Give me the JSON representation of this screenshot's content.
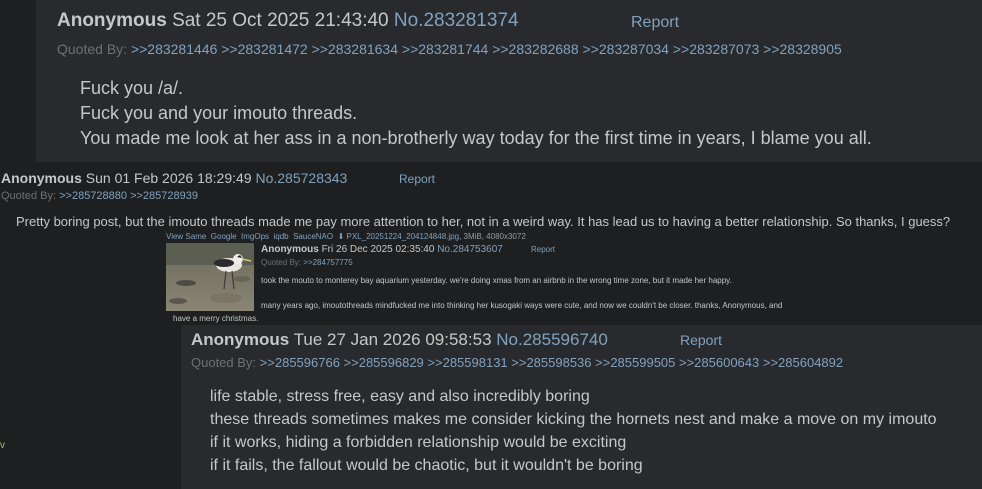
{
  "post1": {
    "name": "Anonymous",
    "datetime": "Sat 25 Oct 2025 21:43:40",
    "number": "No.283281374",
    "report": "Report",
    "quoted_label": "Quoted By:",
    "quoted": ">>283281446 >>283281472 >>283281634 >>283281744 >>283282688 >>283287034 >>283287073 >>28328905",
    "lines": [
      "Fuck you /a/.",
      "Fuck you and your imouto threads.",
      "You made me look at her ass in a non-brotherly way today for the first time in years, I blame you all."
    ]
  },
  "post2": {
    "name": "Anonymous",
    "datetime": "Sun 01 Feb 2026 18:29:49",
    "number": "No.285728343",
    "report": "Report",
    "quoted_label": "Quoted By:",
    "quoted": ">>285728880 >>285728939",
    "line": "Pretty boring post, but the imouto threads made me pay more attention to her, not in a weird way. It has lead us to having a better relationship. So thanks, I guess?"
  },
  "post3": {
    "file_tools": [
      "View Same",
      "Google",
      "ImgOps",
      "iqdb",
      "SauceNAO"
    ],
    "download_icon": "download-icon",
    "filename": "PXL_20251224_204124848.jpg",
    "fileinfo": ", 3MiB, 4080x3072",
    "name": "Anonymous",
    "datetime": "Fri 26 Dec 2025 02:35:40",
    "number": "No.284753607",
    "report": "Report",
    "quoted_label": "Quoted By:",
    "quoted": ">>284757775",
    "line1": "took the mouto to monterey bay aquarium yesterday. we're doing xmas from an airbnb in the wrong time zone, but it made her happy.",
    "line2": "many years ago, imoutothreads mindfucked me into thinking her kusogaki ways were cute, and now we couldn't be closer. thanks, Anonymous, and",
    "line3": "have a merry christmas."
  },
  "post4": {
    "name": "Anonymous",
    "datetime": "Tue 27 Jan 2026 09:58:53",
    "number": "No.285596740",
    "report": "Report",
    "quoted_label": "Quoted By:",
    "quoted": ">>285596766 >>285596829 >>285598131 >>285598536 >>285599505 >>285600643 >>285604892",
    "lines": [
      "life stable, stress free, easy and also incredibly boring",
      "these threads sometimes makes me consider kicking the hornets nest and make a move on my imouto",
      "if it works, hiding a forbidden relationship would be exciting",
      "if it fails, the fallout would be chaotic, but it wouldn't be boring"
    ]
  },
  "edge_mark": "v",
  "colors": {
    "background": "#1d1f21",
    "post_background": "#282a2e",
    "text": "#c5c8c6",
    "link": "#81a2be",
    "muted": "#707070"
  }
}
